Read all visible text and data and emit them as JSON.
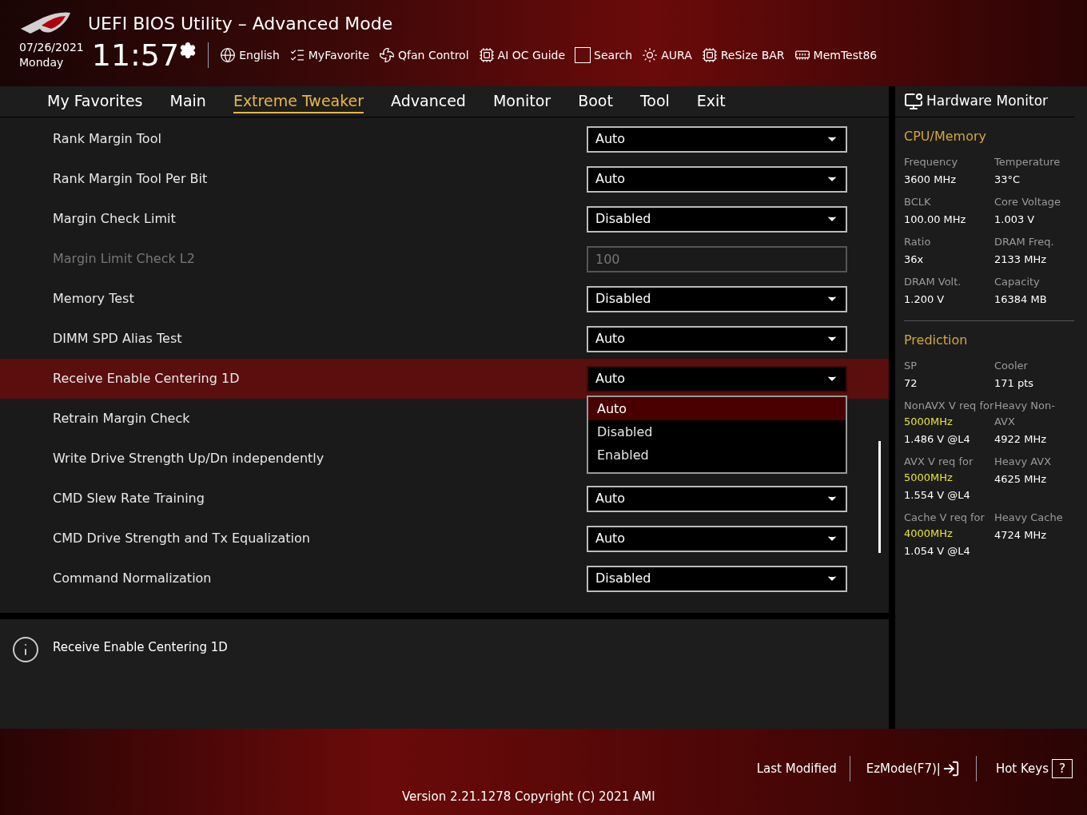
{
  "window": {
    "title": "UEFI BIOS Utility – Advanced Mode"
  },
  "clock": {
    "date": "07/26/2021",
    "weekday": "Monday",
    "time": "11:57"
  },
  "toolbar": [
    {
      "label": "English",
      "kind": "globe"
    },
    {
      "label": "MyFavorite",
      "kind": "favorite"
    },
    {
      "label": "Qfan Control",
      "kind": "fan"
    },
    {
      "label": "AI OC Guide",
      "kind": "guide"
    },
    {
      "label": "Search",
      "kind": "search"
    },
    {
      "label": "AURA",
      "kind": "aura"
    },
    {
      "label": "ReSize BAR",
      "kind": "bar"
    },
    {
      "label": "MemTest86",
      "kind": "memory"
    }
  ],
  "tabs": [
    {
      "label": "My Favorites",
      "selected": false
    },
    {
      "label": "Main",
      "selected": false
    },
    {
      "label": "Extreme Tweaker",
      "selected": true
    },
    {
      "label": "Advanced",
      "selected": false
    },
    {
      "label": "Monitor",
      "selected": false
    },
    {
      "label": "Boot",
      "selected": false
    },
    {
      "label": "Tool",
      "selected": false
    },
    {
      "label": "Exit",
      "selected": false
    }
  ],
  "settings": [
    {
      "label": "Rank Margin Tool",
      "kind": "dropdown",
      "value": "Auto",
      "disabled": false,
      "selected": false
    },
    {
      "label": "Rank Margin Tool Per Bit",
      "kind": "dropdown",
      "value": "Auto",
      "disabled": false,
      "selected": false
    },
    {
      "label": "Margin Check Limit",
      "kind": "dropdown",
      "value": "Disabled",
      "disabled": false,
      "selected": false
    },
    {
      "label": "Margin Limit Check L2",
      "kind": "field",
      "value": "100",
      "disabled": true,
      "selected": false
    },
    {
      "label": "Memory Test",
      "kind": "dropdown",
      "value": "Disabled",
      "disabled": false,
      "selected": false
    },
    {
      "label": "DIMM SPD Alias Test",
      "kind": "dropdown",
      "value": "Auto",
      "disabled": false,
      "selected": false
    },
    {
      "label": "Receive Enable Centering 1D",
      "kind": "dropdown",
      "value": "Auto",
      "disabled": false,
      "selected": true,
      "expanded": true,
      "options": [
        {
          "label": "Auto",
          "selected": true
        },
        {
          "label": "Disabled",
          "selected": false
        },
        {
          "label": "Enabled",
          "selected": false
        }
      ]
    },
    {
      "label": "Retrain Margin Check",
      "kind": "dropdown",
      "disabled": false,
      "selected": false
    },
    {
      "label": "Write Drive Strength Up/Dn independently",
      "kind": "dropdown",
      "disabled": false,
      "selected": false
    },
    {
      "label": "CMD Slew Rate Training",
      "kind": "dropdown",
      "value": "Auto",
      "disabled": false,
      "selected": false
    },
    {
      "label": "CMD Drive Strength and Tx Equalization",
      "kind": "dropdown",
      "value": "Auto",
      "disabled": false,
      "selected": false
    },
    {
      "label": "Command Normalization",
      "kind": "dropdown",
      "value": "Disabled",
      "disabled": false,
      "selected": false
    }
  ],
  "help": {
    "text": "Receive Enable Centering 1D"
  },
  "hardware_monitor": {
    "title": "Hardware Monitor",
    "sections": [
      {
        "title": "CPU/Memory",
        "items": [
          {
            "label": "Frequency",
            "value": "3600 MHz"
          },
          {
            "label": "Temperature",
            "value": "33°C"
          },
          {
            "label": "BCLK",
            "value": "100.00 MHz"
          },
          {
            "label": "Core Voltage",
            "value": "1.003 V"
          },
          {
            "label": "Ratio",
            "value": "36x"
          },
          {
            "label": "DRAM Freq.",
            "value": "2133 MHz"
          },
          {
            "label": "DRAM Volt.",
            "value": "1.200 V"
          },
          {
            "label": "Capacity",
            "value": "16384 MB"
          }
        ]
      },
      {
        "title": "Prediction",
        "items": [
          {
            "label": "SP",
            "value": "72"
          },
          {
            "label": "Cooler",
            "value": "171 pts"
          },
          {
            "label": "NonAVX V req for **5000MHz**",
            "value": "1.486 V @L4"
          },
          {
            "label": "Heavy Non-AVX",
            "value": "4922 MHz"
          },
          {
            "label": "AVX V req for **5000MHz**",
            "value": "1.554 V @L4"
          },
          {
            "label": "Heavy AVX",
            "value": "4625 MHz"
          },
          {
            "label": "Cache V req for **4000MHz**",
            "value": "1.054 V @L4"
          },
          {
            "label": "Heavy Cache",
            "value": "4724 MHz"
          }
        ]
      }
    ]
  },
  "footer": {
    "last_modified": "Last Modified",
    "ezmode": "EzMode(F7)|",
    "hotkeys": "Hot Keys",
    "hotkeys_icon": "?",
    "version": "Version 2.21.1278 Copyright (C) 2021 AMI"
  }
}
